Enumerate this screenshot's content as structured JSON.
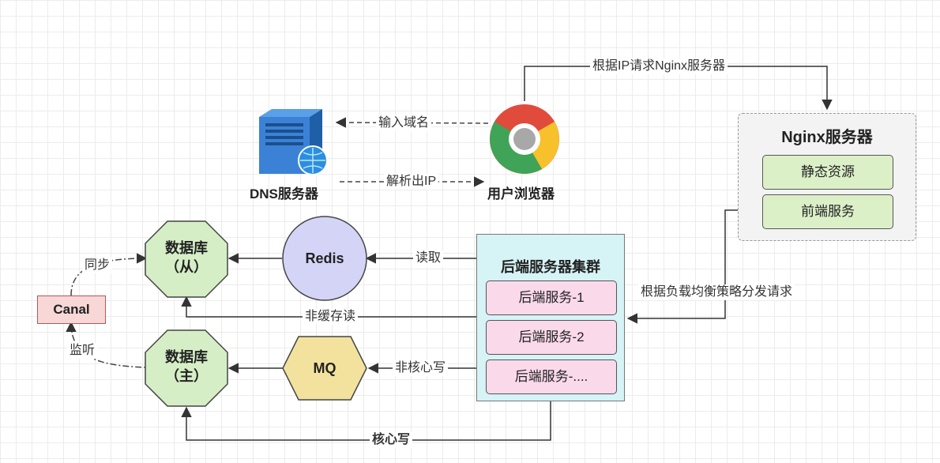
{
  "dns": {
    "label": "DNS服务器"
  },
  "browser": {
    "label": "用户浏览器"
  },
  "edges": {
    "input_domain": "输入域名",
    "resolve_ip": "解析出IP",
    "request_nginx": "根据IP请求Nginx服务器",
    "load_balance": "根据负载均衡策略分发请求",
    "read": "读取",
    "non_cache_read": "非缓存读",
    "non_core_write": "非核心写",
    "core_write": "核心写",
    "sync": "同步",
    "listen": "监听"
  },
  "nginx": {
    "title": "Nginx服务器",
    "items": [
      "静态资源",
      "前端服务"
    ]
  },
  "cluster": {
    "title": "后端服务器集群",
    "services": [
      "后端服务-1",
      "后端服务-2",
      "后端服务-...."
    ]
  },
  "redis": {
    "label": "Redis"
  },
  "mq": {
    "label": "MQ"
  },
  "db_slave": {
    "line1": "数据库",
    "line2": "（从）"
  },
  "db_master": {
    "line1": "数据库",
    "line2": "（主）"
  },
  "canal": {
    "label": "Canal"
  },
  "colors": {
    "redis_fill": "#d4d4f6",
    "mq_fill": "#f2e29e",
    "db_fill": "#d6eec6",
    "nginx_item_fill": "#dcf0c8",
    "service_fill": "#f9d9ea",
    "cluster_fill": "#d6f3f6",
    "canal_fill": "#f8d7d7"
  }
}
